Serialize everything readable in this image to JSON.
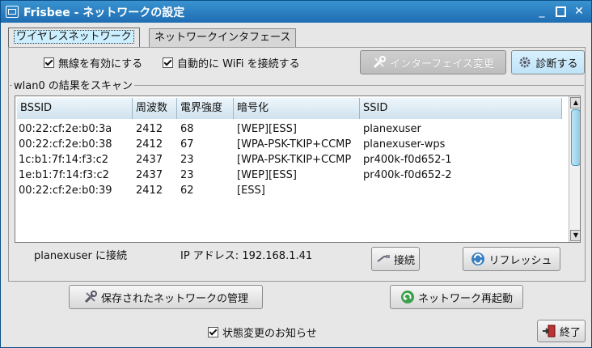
{
  "window": {
    "title": "Frisbee - ネットワークの設定"
  },
  "tabs": [
    {
      "label": "ワイヤレスネットワーク",
      "active": true
    },
    {
      "label": "ネットワークインタフェース",
      "active": false
    }
  ],
  "options": {
    "enable_wireless": {
      "label": "無線を有効にする",
      "checked": true
    },
    "auto_connect": {
      "label": "自動的に WiFi を接続する",
      "checked": true
    }
  },
  "buttons": {
    "change_interface": "インターフェイス変更",
    "diagnose": "診断する",
    "connect": "接続",
    "refresh": "リフレッシュ",
    "manage_saved": "保存されたネットワークの管理",
    "restart_network": "ネットワーク再起動",
    "quit": "終了"
  },
  "scan": {
    "group_label": "wlan0 の結果をスキャン",
    "columns": [
      "BSSID",
      "周波数",
      "電界強度",
      "暗号化",
      "SSID"
    ],
    "rows": [
      {
        "bssid": "00:22:cf:2e:b0:3a",
        "freq": "2412",
        "signal": "68",
        "enc": "[WEP][ESS]",
        "ssid": "planexuser"
      },
      {
        "bssid": "00:22:cf:2e:b0:38",
        "freq": "2412",
        "signal": "67",
        "enc": "[WPA-PSK-TKIP+CCMP",
        "ssid": "planexuser-wps"
      },
      {
        "bssid": "1c:b1:7f:14:f3:c2",
        "freq": "2437",
        "signal": "23",
        "enc": "[WPA-PSK-TKIP+CCMP",
        "ssid": "pr400k-f0d652-1"
      },
      {
        "bssid": "1e:b1:7f:14:f3:c2",
        "freq": "2437",
        "signal": "23",
        "enc": "[WEP][ESS]",
        "ssid": "pr400k-f0d652-2"
      },
      {
        "bssid": "00:22:cf:2e:b0:39",
        "freq": "2412",
        "signal": "62",
        "enc": "[ESS]",
        "ssid": ""
      }
    ]
  },
  "status": {
    "connected": "planexuser に接続",
    "ip": "IP アドレス: 192.168.1.41"
  },
  "notify": {
    "label": "状態変更のお知らせ",
    "checked": true
  }
}
